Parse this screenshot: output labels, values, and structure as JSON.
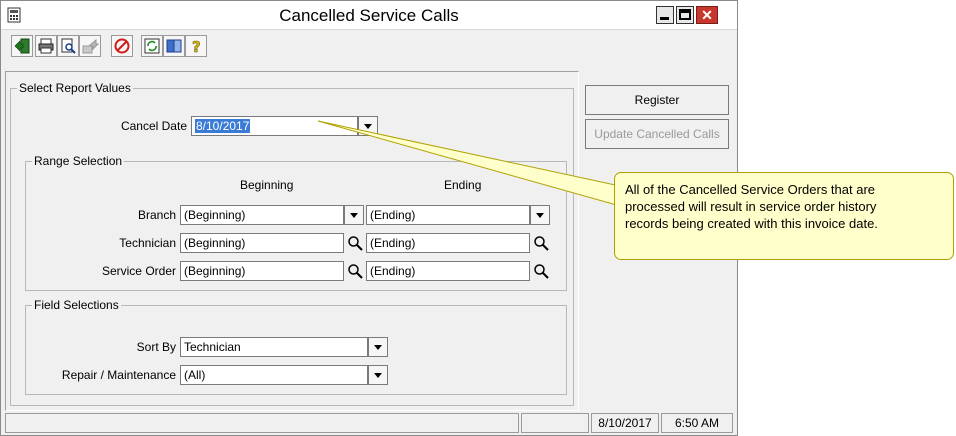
{
  "window": {
    "title": "Cancelled Service Calls"
  },
  "toolbar": {
    "icons": [
      "exit-icon",
      "print-icon",
      "print-preview-icon",
      "export-icon",
      "cancel-icon",
      "refresh-icon",
      "info-icon",
      "help-icon"
    ]
  },
  "report": {
    "group_title": "Select Report Values",
    "cancel_date_label": "Cancel Date",
    "cancel_date_value": "8/10/2017"
  },
  "range": {
    "group_title": "Range Selection",
    "beginning_header": "Beginning",
    "ending_header": "Ending",
    "rows": [
      {
        "label": "Branch",
        "begin": "(Beginning)",
        "end": "(Ending)"
      },
      {
        "label": "Technician",
        "begin": "(Beginning)",
        "end": "(Ending)"
      },
      {
        "label": "Service Order",
        "begin": "(Beginning)",
        "end": "(Ending)"
      }
    ]
  },
  "fields": {
    "group_title": "Field Selections",
    "sort_by_label": "Sort By",
    "sort_by_value": "Technician",
    "repair_label": "Repair / Maintenance",
    "repair_value": "(All)"
  },
  "buttons": {
    "register": "Register",
    "update": "Update Cancelled Calls"
  },
  "status": {
    "date": "8/10/2017",
    "time": "6:50 AM"
  },
  "callout": {
    "lines": [
      "All of the Cancelled Service Orders that are",
      "processed will result in service order history",
      "records being created with this invoice date."
    ]
  },
  "colors": {
    "window_bg": "#f0f0f0",
    "callout_bg": "#ffffcc",
    "close_button": "#c8372d",
    "selection": "#3a7bd5"
  }
}
